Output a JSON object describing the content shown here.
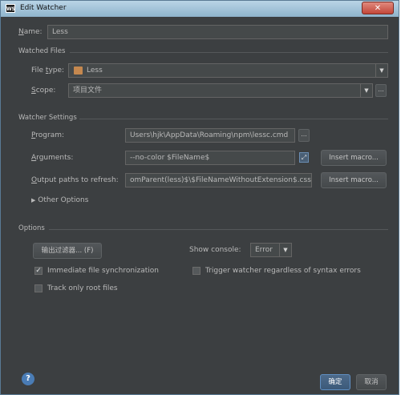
{
  "window": {
    "title": "Edit Watcher",
    "app_icon_text": "WS",
    "close_symbol": "✕"
  },
  "name": {
    "label": "Name:",
    "value": "Less"
  },
  "watched_files": {
    "section_title": "Watched Files",
    "file_type": {
      "label": "File type:",
      "value": "Less"
    },
    "scope": {
      "label": "Scope:",
      "value": "项目文件",
      "more_label": "..."
    }
  },
  "watcher_settings": {
    "section_title": "Watcher Settings",
    "program": {
      "label": "Program:",
      "value": "Users\\hjk\\AppData\\Roaming\\npm\\lessc.cmd",
      "more_label": "..."
    },
    "arguments": {
      "label": "Arguments:",
      "value": "--no-color $FileName$",
      "insert_macro": "Insert macro..."
    },
    "output_paths": {
      "label": "Output paths to refresh:",
      "value": "omParent(less)$\\$FileNameWithoutExtension$.css",
      "insert_macro": "Insert macro..."
    },
    "other_options": "Other Options"
  },
  "options": {
    "section_title": "Options",
    "output_filters_button": "输出过滤器... (F)",
    "show_console_label": "Show console:",
    "show_console_value": "Error",
    "immediate_sync": {
      "label": "Immediate file synchronization",
      "checked": true
    },
    "trigger_watcher": {
      "label": "Trigger watcher regardless of syntax errors",
      "checked": false
    },
    "track_root": {
      "label": "Track only root files",
      "checked": false
    }
  },
  "footer": {
    "help": "?",
    "ok": "确定",
    "cancel": "取消"
  },
  "colors": {
    "background": "#3c3f41",
    "field": "#45494a",
    "accent": "#4a7cb5"
  }
}
